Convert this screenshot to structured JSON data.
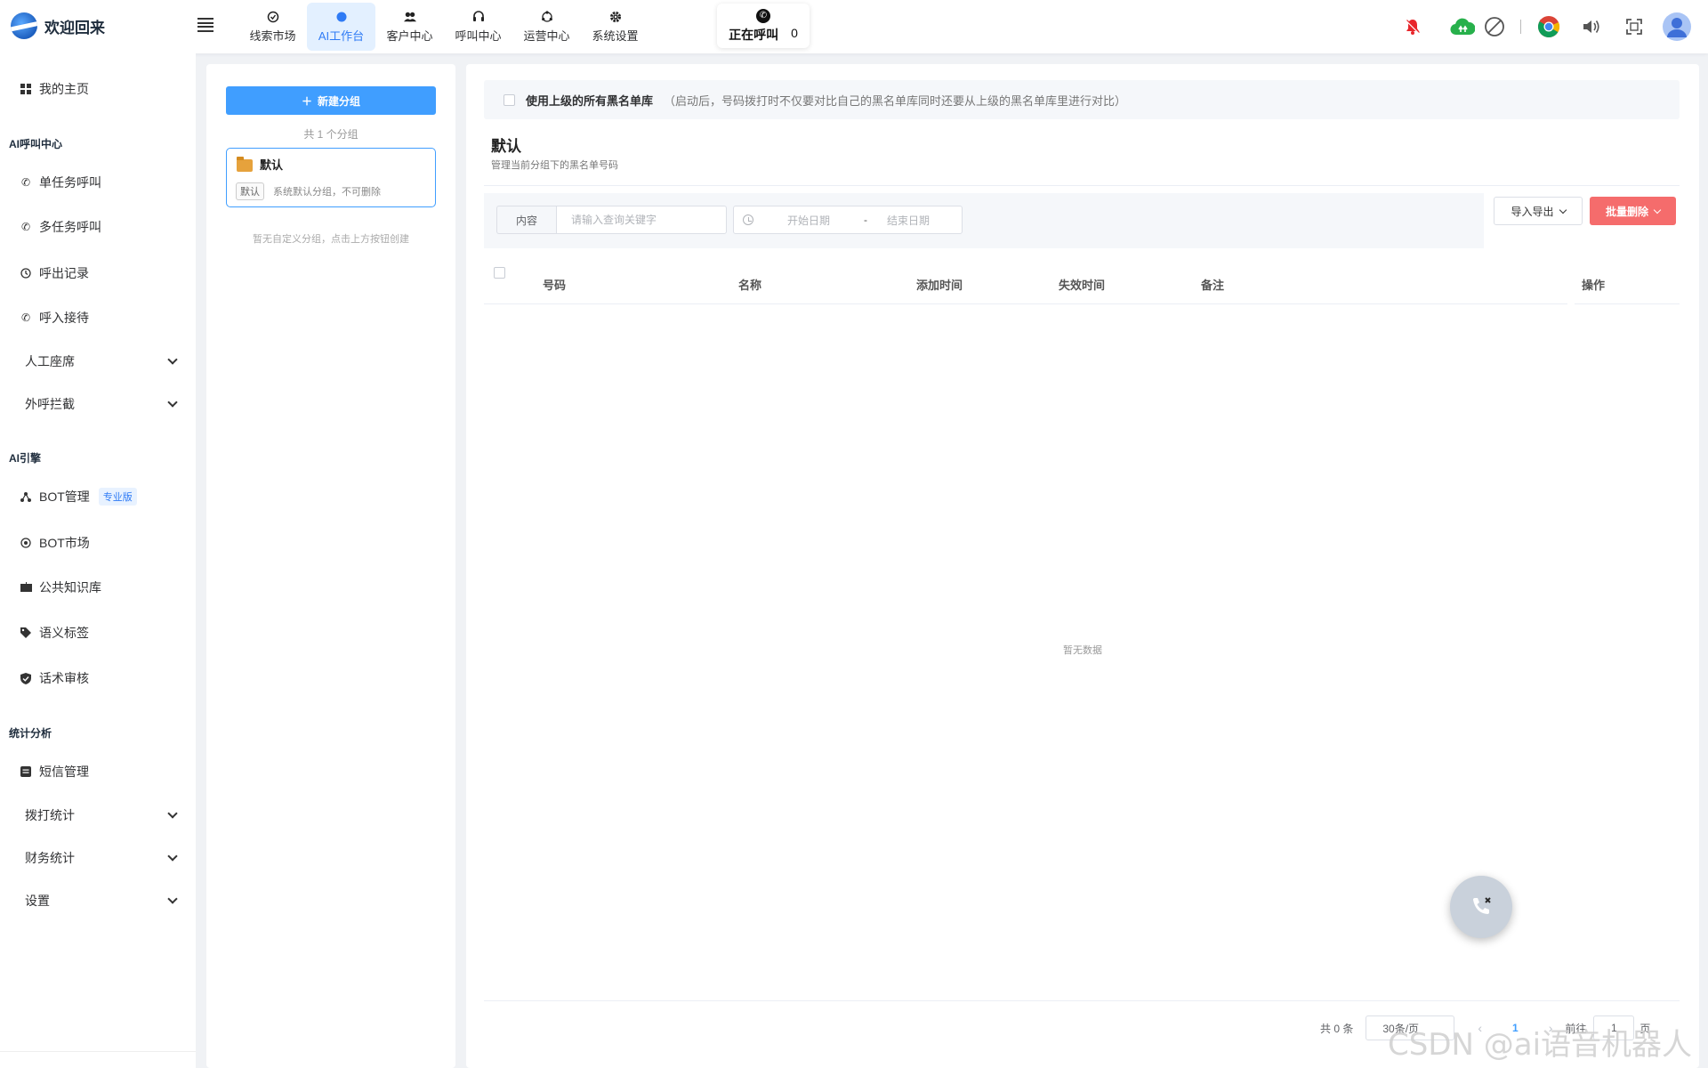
{
  "app": {
    "title": "欢迎回来"
  },
  "topnav": [
    {
      "label": "线索市场",
      "icon": "target-icon"
    },
    {
      "label": "AI工作台",
      "icon": "ai-dot-icon",
      "active": true
    },
    {
      "label": "客户中心",
      "icon": "users-icon"
    },
    {
      "label": "呼叫中心",
      "icon": "headset-icon"
    },
    {
      "label": "运营中心",
      "icon": "cycle-icon"
    },
    {
      "label": "系统设置",
      "icon": "gear-icon"
    }
  ],
  "calling": {
    "label": "正在呼叫",
    "count": "0"
  },
  "sidebar": {
    "home": "我的主页",
    "group_ai_call": "AI呼叫中心",
    "single_call": "单任务呼叫",
    "multi_call": "多任务呼叫",
    "outbound_records": "呼出记录",
    "inbound": "呼入接待",
    "manual_seat": "人工座席",
    "outbound_intercept": "外呼拦截",
    "group_ai_engine": "AI引擎",
    "bot_manage": "BOT管理",
    "bot_manage_badge": "专业版",
    "bot_market": "BOT市场",
    "public_kb": "公共知识库",
    "semantic_tags": "语义标签",
    "script_review": "话术审核",
    "group_stats": "统计分析",
    "sms_manage": "短信管理",
    "dial_stats": "拨打统计",
    "finance_stats": "财务统计",
    "settings": "设置"
  },
  "groups": {
    "new_button": "新建分组",
    "count_text": "共 1 个分组",
    "items": [
      {
        "name": "默认",
        "tag": "默认",
        "desc": "系统默认分组，不可删除"
      }
    ],
    "empty_hint": "暂无自定义分组，点击上方按钮创建"
  },
  "main": {
    "notice_label": "使用上级的所有黑名单库",
    "notice_hint": "（启动后，号码拨打时不仅要对比自己的黑名单库同时还要从上级的黑名单库里进行对比）",
    "title": "默认",
    "subtitle": "管理当前分组下的黑名单号码",
    "filter": {
      "field_label": "内容",
      "search_placeholder": "请输入查询关键字",
      "start_date": "开始日期",
      "date_sep": "-",
      "end_date": "结束日期"
    },
    "import_export": "导入导出",
    "batch_delete": "批量删除",
    "columns": [
      "号码",
      "名称",
      "添加时间",
      "失效时间",
      "备注",
      "操作"
    ],
    "empty_text": "暂无数据"
  },
  "pagination": {
    "total": "共 0 条",
    "page_size": "30条/页",
    "prev": "‹",
    "current": "1",
    "next": "›",
    "goto": "前往",
    "jump": "1",
    "unit": "页"
  },
  "watermark": "CSDN @ai语音机器人",
  "colors": {
    "primary": "#409eff",
    "danger": "#f56c6c",
    "active_nav_bg": "#e3f0ff"
  }
}
